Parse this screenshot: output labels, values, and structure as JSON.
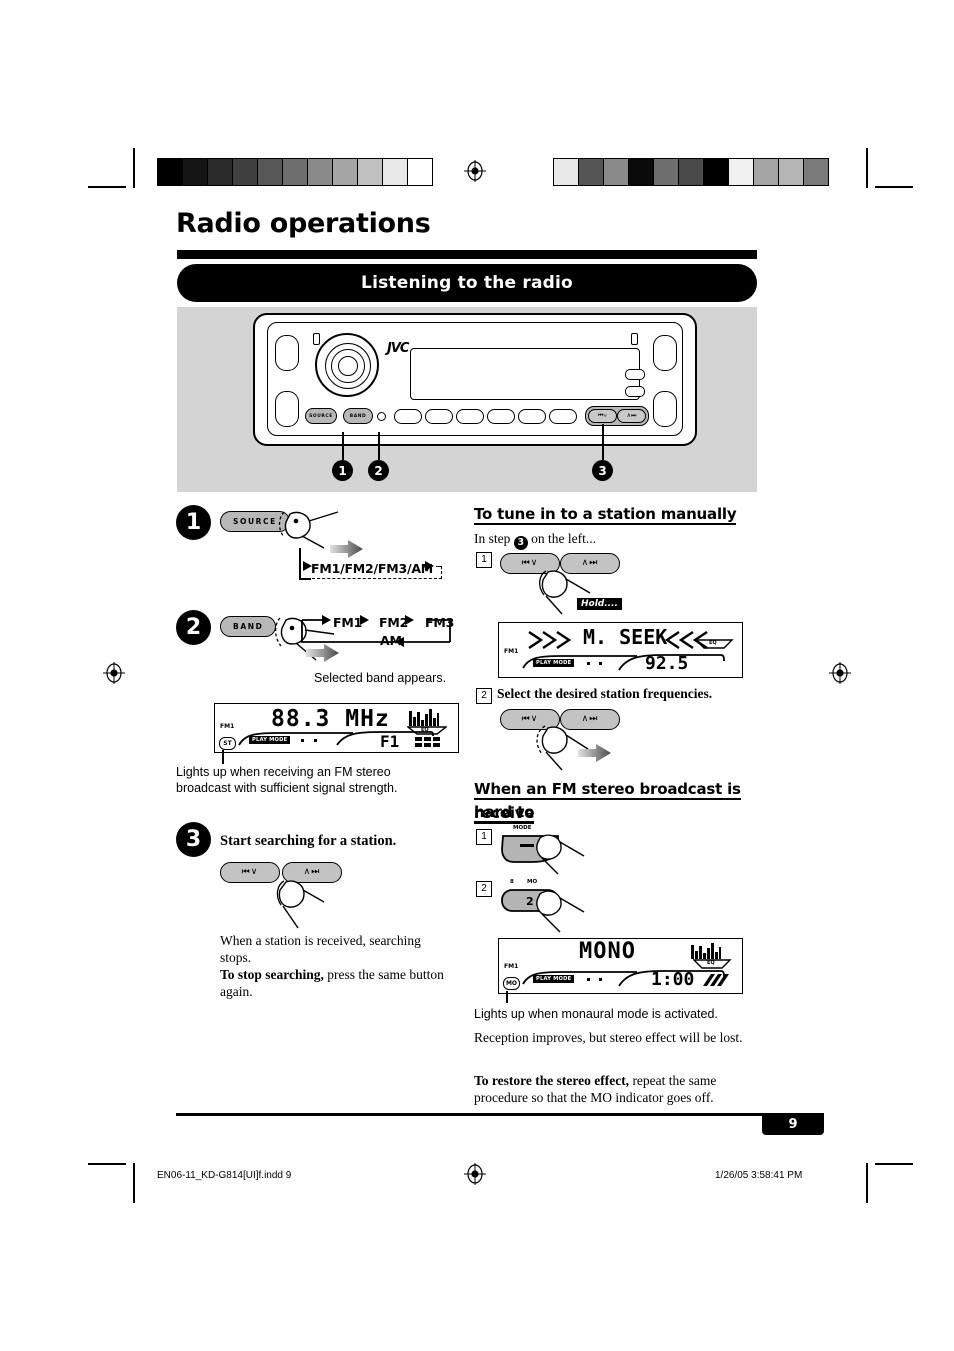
{
  "page": {
    "title": "Radio operations",
    "section_banner": "Listening to the radio",
    "page_number": "9"
  },
  "device": {
    "brand": "JVC",
    "buttons": {
      "source": "SOURCE",
      "band": "BAND",
      "seek_down": "⏮∨",
      "seek_up": "∧⏭"
    },
    "callouts": [
      "1",
      "2",
      "3"
    ]
  },
  "left_column": {
    "step1": {
      "number": "1",
      "button_label": "SOURCE",
      "cycle": "FM1/FM2/FM3/AM"
    },
    "step2": {
      "number": "2",
      "button_label": "BAND",
      "cycle_items": [
        "FM1",
        "FM2",
        "FM3",
        "AM"
      ],
      "caption": "Selected band appears."
    },
    "display_tuned": {
      "frequency": "88.3 MHz",
      "band_indicator": "FM1",
      "stereo_indicator": "ST",
      "preset_indicator": "F1",
      "play_mode_label": "PLAY MODE",
      "eq_label": "EQ"
    },
    "stereo_note": "Lights up when receiving an FM stereo broadcast with sufficient signal strength.",
    "step3": {
      "number": "3",
      "heading": "Start searching for a station.",
      "seek_down": "⏮∨",
      "seek_up": "∧⏭",
      "body_line1": "When a station is received, searching stops.",
      "body_bold": "To stop searching,",
      "body_line2": " press the same button again."
    }
  },
  "right_column": {
    "manual_tune": {
      "heading": "To tune in to a station manually",
      "intro_pre": "In step ",
      "intro_step": "3",
      "intro_post": " on the left...",
      "sub1_number": "1",
      "seek_down": "⏮∨",
      "seek_up": "∧⏭",
      "hold_label": "Hold....",
      "display_seek": {
        "mode_text": "M. SEEK",
        "arrows_left": ">>>",
        "arrows_right": "<<<",
        "frequency": "92.5",
        "band_indicator": "FM1",
        "play_mode_label": "PLAY MODE",
        "eq_label": "EQ"
      },
      "sub2_number": "2",
      "sub2_text": "Select the desired station frequencies."
    },
    "mono_section": {
      "heading_line1": "When an FM stereo broadcast is hard to",
      "heading_line2": "receive",
      "sub1_number": "1",
      "mode_button_label": "MODE",
      "mode_button_glyph": "–",
      "sub2_number": "2",
      "mo_button_label_left": "8",
      "mo_button_label_right": "MO",
      "mo_button_glyph": "2",
      "display_mono": {
        "mode_text": "MONO",
        "band_indicator": "FM1",
        "mo_indicator": "MO",
        "timer": "1:00",
        "play_mode_label": "PLAY MODE",
        "eq_label": "EQ"
      },
      "note_mono": "Lights up when monaural mode is activated.",
      "note_reception": "Reception improves, but stereo effect will be lost.",
      "restore_bold": "To restore the stereo effect,",
      "restore_rest": " repeat the same procedure so that the MO indicator goes off."
    }
  },
  "footer": {
    "filename": "EN06-11_KD-G814[UI]f.indd   9",
    "timestamp": "1/26/05   3:58:41 PM"
  },
  "colors": {
    "ink": "#000000",
    "panel_gray": "#d4d4d4",
    "button_gray": "#b8b8b8"
  }
}
